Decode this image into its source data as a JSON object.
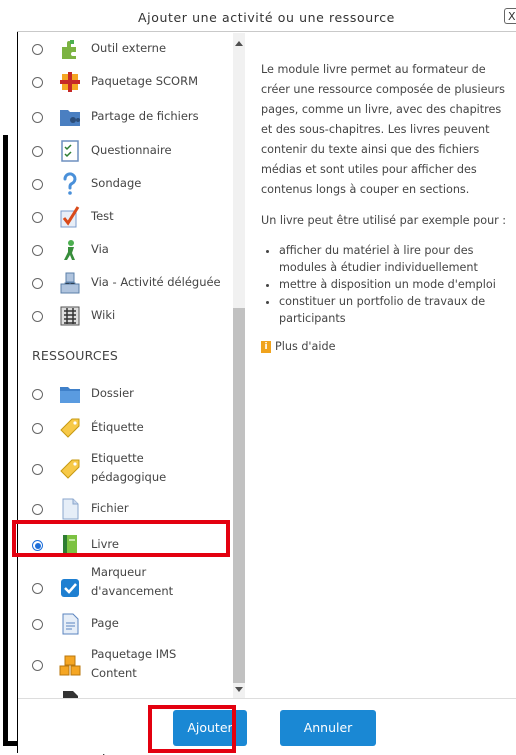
{
  "dialog": {
    "title": "Ajouter une activité ou une ressource",
    "close_label": "X"
  },
  "list": {
    "activities": [
      {
        "label": "Outil externe",
        "icon": "puzzle-icon"
      },
      {
        "label": "Paquetage SCORM",
        "icon": "scorm-package-icon"
      },
      {
        "label": "Partage de fichiers",
        "icon": "file-share-folder-icon"
      },
      {
        "label": "Questionnaire",
        "icon": "questionnaire-icon"
      },
      {
        "label": "Sondage",
        "icon": "question-mark-icon"
      },
      {
        "label": "Test",
        "icon": "checkmark-test-icon"
      },
      {
        "label": "Via",
        "icon": "via-icon"
      },
      {
        "label": "Via - Activité déléguée",
        "icon": "via-delegated-icon"
      },
      {
        "label": "Wiki",
        "icon": "wiki-icon"
      }
    ],
    "section_heading": "RESSOURCES",
    "resources": [
      {
        "label": "Dossier",
        "icon": "folder-icon"
      },
      {
        "label": "Étiquette",
        "icon": "tag-icon"
      },
      {
        "label": "Etiquette\npédagogique",
        "icon": "tag-icon"
      },
      {
        "label": "Fichier",
        "icon": "file-icon"
      },
      {
        "label": "Livre",
        "icon": "book-icon",
        "selected": true
      },
      {
        "label": "Marqueur\nd'avancement",
        "icon": "checkbox-icon"
      },
      {
        "label": "Page",
        "icon": "page-icon"
      },
      {
        "label": "Paquetage IMS\nContent",
        "icon": "ims-package-icon"
      }
    ]
  },
  "description": {
    "para1": "Le module livre permet au formateur de créer une ressource composée de plusieurs pages, comme un livre, avec des chapitres et des sous-chapitres. Les livres peuvent contenir du texte ainsi que des fichiers médias et sont utiles pour afficher des contenus longs à couper en sections.",
    "para2": "Un livre peut être utilisé par exemple pour :",
    "bullets": [
      "afficher du matériel à lire pour des modules à étudier individuellement",
      "mettre à disposition un mode d'emploi",
      "constituer un portfolio de travaux de participants"
    ],
    "help_link": "Plus d'aide"
  },
  "footer": {
    "add_label": "Ajouter",
    "cancel_label": "Annuler"
  },
  "colors": {
    "accent": "#1a88d4",
    "highlight": "#e3000f"
  }
}
